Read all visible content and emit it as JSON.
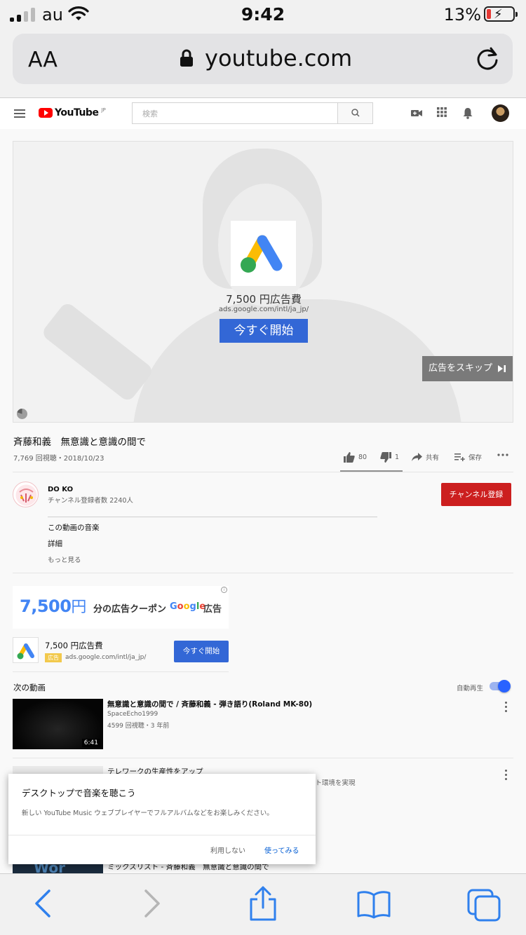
{
  "status_bar": {
    "carrier": "au",
    "time": "9:42",
    "battery": "13%"
  },
  "browser": {
    "text_size_label": "AA",
    "url": "youtube.com"
  },
  "youtube_header": {
    "logo_text": "YouTube",
    "logo_region": "JP",
    "search_placeholder": "検索"
  },
  "ad_player": {
    "price_text": "7,500 円広告費",
    "url_text": "ads.google.com/intl/ja_jp/",
    "cta_label": "今すぐ開始",
    "skip_label": "広告をスキップ"
  },
  "video": {
    "title": "斉藤和義　無意識と意識の間で",
    "meta": "7,769 回視聴・2018/10/23",
    "likes": "80",
    "dislikes": "1",
    "share_label": "共有",
    "save_label": "保存"
  },
  "channel": {
    "name": "DO KO",
    "subscribers": "チャンネル登録者数 2240人",
    "subscribe_label": "チャンネル登録",
    "description_line1": "この動画の音楽",
    "description_line2": "詳細",
    "show_more": "もっと見る"
  },
  "banner_ad": {
    "amount": "7,500",
    "yen": "円",
    "coupon_text": "分の広告クーポン",
    "google_text": "Google",
    "ad_word": "広告",
    "info_glyph": "i",
    "title": "7,500 円広告費",
    "badge": "広告",
    "url": "ads.google.com/intl/ja_jp/",
    "cta_label": "今すぐ開始"
  },
  "up_next": {
    "heading": "次の動画",
    "autoplay_label": "自動再生",
    "autoplay_on": true,
    "videos": [
      {
        "title": "無意識と意識の間で / 斉藤和義 - 弾き語り(Roland MK-80)",
        "channel": "SpaceEcho1999",
        "meta": "4599 回視聴・3 年前",
        "duration": "6:41"
      },
      {
        "title": "テレワークの生産性をアップ",
        "subtitle": "ント環境を実現"
      },
      {
        "title": "ミックスリスト - 斉藤和義　無意識と意識の間で",
        "thumb_text": "Wor"
      }
    ]
  },
  "popup": {
    "title": "デスクトップで音楽を聴こう",
    "message": "新しい YouTube Music ウェブプレイヤーでフルアルバムなどをお楽しみください。",
    "dismiss_label": "利用しない",
    "accept_label": "使ってみる"
  },
  "colors": {
    "youtube_red": "#ff0000",
    "subscribe_red": "#cc1f1f",
    "ad_blue": "#3367d6",
    "safari_blue": "#2f80ed",
    "link_blue": "#065fd4"
  }
}
